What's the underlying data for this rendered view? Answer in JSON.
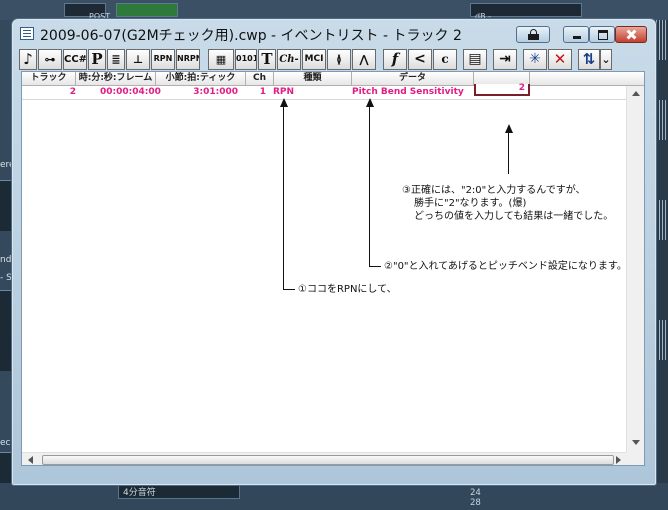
{
  "window": {
    "title": "2009-06-07(G2Mチェック用).cwp - イベントリスト - トラック 2"
  },
  "toolbar": {
    "buttons": [
      {
        "name": "note-filter-button",
        "glyph": "♪"
      },
      {
        "name": "key-aftertouch-button",
        "glyph": "⊶"
      },
      {
        "name": "controller-button",
        "glyph": "CC#"
      },
      {
        "name": "patch-button",
        "glyph": "P"
      },
      {
        "name": "channel-aftertouch-button",
        "glyph": "≣"
      },
      {
        "name": "pitch-wheel-button",
        "glyph": "⊥"
      },
      {
        "name": "rpn-button",
        "glyph": "RPN"
      },
      {
        "name": "nrpn-button",
        "glyph": "NRPN"
      },
      {
        "name": "sysex-bank-button",
        "glyph": "▦"
      },
      {
        "name": "sysex-data-button",
        "glyph": "0101"
      },
      {
        "name": "text-button",
        "glyph": "T"
      },
      {
        "name": "channel-button",
        "glyph": "Ch-"
      },
      {
        "name": "mci-button",
        "glyph": "MCI"
      },
      {
        "name": "audio-button",
        "glyph": "≬"
      },
      {
        "name": "shape-button",
        "glyph": "⋀"
      },
      {
        "name": "expression-button",
        "glyph": "f"
      },
      {
        "name": "hairpin-button",
        "glyph": "<"
      },
      {
        "name": "chord-button",
        "glyph": "c"
      },
      {
        "name": "list-button",
        "glyph": "▤"
      },
      {
        "name": "exit-button",
        "glyph": "⇥"
      },
      {
        "name": "insert-event-button",
        "glyph": "✳"
      },
      {
        "name": "delete-event-button",
        "glyph": "✕"
      },
      {
        "name": "sort-button",
        "glyph": "⇅"
      },
      {
        "name": "sort-dropdown",
        "glyph": "⌄"
      }
    ]
  },
  "columns": {
    "track": "トラック",
    "time": "時:分:秒:フレーム",
    "mbt": "小節:拍:ティック",
    "ch": "Ch",
    "kind": "種類",
    "data": "データ",
    "value": ""
  },
  "event_row": {
    "track": "2",
    "time": "00:00:04:00",
    "mbt": "3:01:000",
    "ch": "1",
    "kind": "RPN",
    "data": "Pitch Bend Sensitivity",
    "value": "2"
  },
  "annotations": {
    "note1": "①ココをRPNにして、",
    "note2": "②\"0\"と入れてあげるとピッチベンド設定になります。",
    "note3_line1": "③正確には、\"2:0\"と入力するんですが、",
    "note3_line2": "勝手に\"2\"なります。(爆)",
    "note3_line3": "どっちの値を入力しても結果は一緒でした。"
  },
  "background": {
    "post_label": "POST",
    "db_label": "dB -",
    "left_labels": [
      "ere",
      "nd",
      "- Sl",
      "ec"
    ],
    "bottom_select": "4分音符",
    "bottom_numbers": [
      "24",
      "28"
    ]
  },
  "colors": {
    "event_text": "#e21d86",
    "edit_border": "#7a1f2a",
    "window_frame": "#aec6d9"
  }
}
